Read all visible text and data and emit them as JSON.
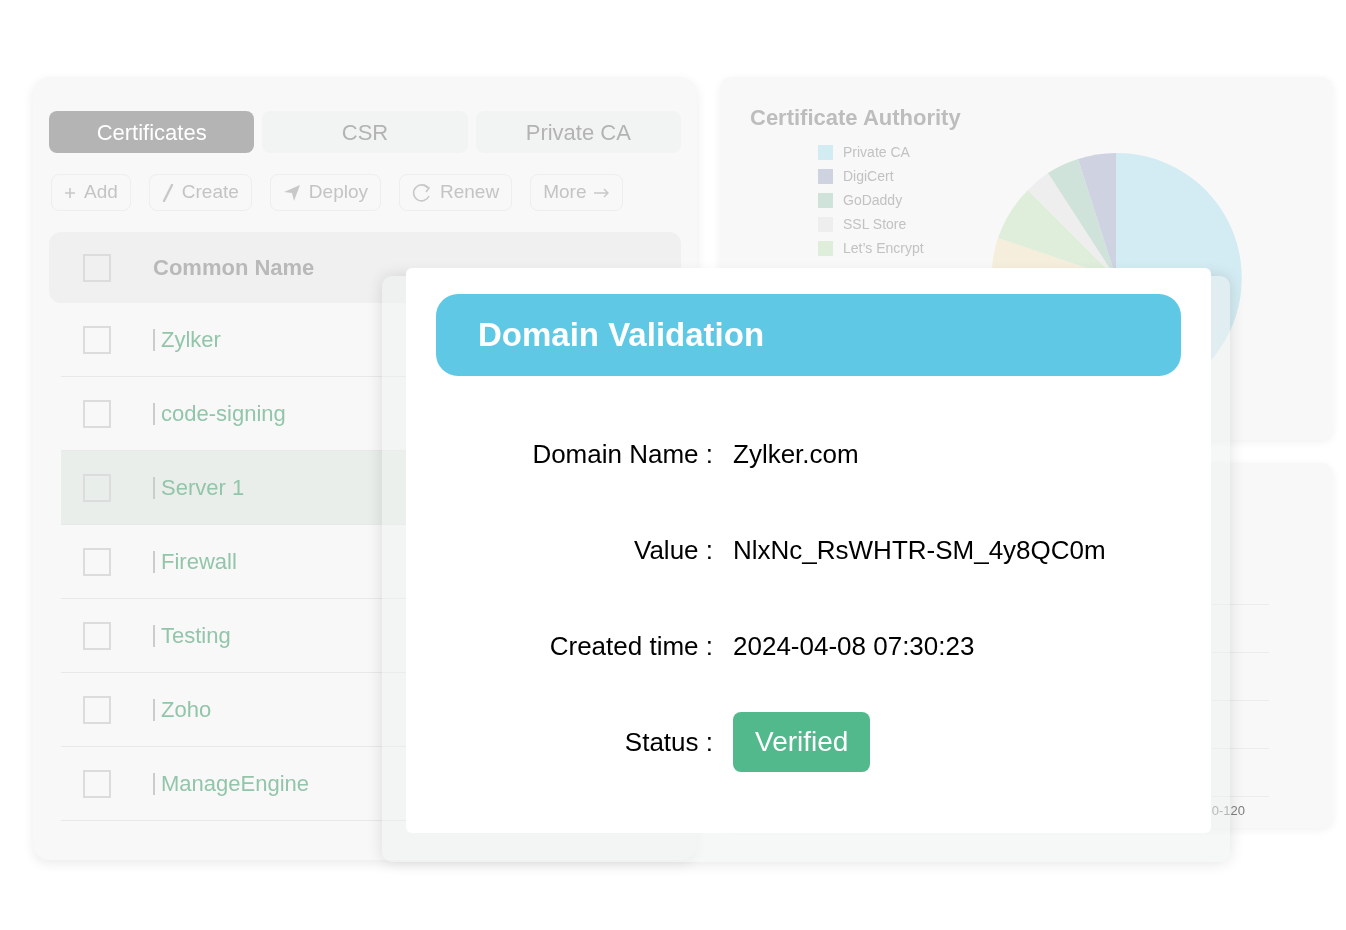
{
  "tabs": [
    {
      "label": "Certificates",
      "selected": true
    },
    {
      "label": "CSR",
      "selected": false
    },
    {
      "label": "Private CA",
      "selected": false
    }
  ],
  "toolbar": [
    {
      "label": "Add",
      "kind": "add"
    },
    {
      "label": "Create",
      "kind": "create"
    },
    {
      "label": "Deploy",
      "kind": "deploy"
    },
    {
      "label": "Renew",
      "kind": "renew"
    },
    {
      "label": "More",
      "kind": "more"
    }
  ],
  "table": {
    "columns": [
      "Common Name"
    ],
    "header_checked": false,
    "rows": [
      {
        "name": "Zylker",
        "checked": false,
        "selected": false
      },
      {
        "name": "code-signing",
        "checked": false,
        "selected": false
      },
      {
        "name": "Server 1",
        "checked": false,
        "selected": true
      },
      {
        "name": "Firewall",
        "checked": false,
        "selected": false
      },
      {
        "name": "Testing",
        "checked": false,
        "selected": false
      },
      {
        "name": "Zoho",
        "checked": false,
        "selected": false
      },
      {
        "name": "ManageEngine",
        "checked": false,
        "selected": false
      }
    ]
  },
  "ca_panel": {
    "title": "Certificate Authority",
    "legend": [
      {
        "label": "Private CA",
        "color": "#d3ebf2"
      },
      {
        "label": "DigiCert",
        "color": "#cfd3e1"
      },
      {
        "label": "GoDaddy",
        "color": "#cfe3da"
      },
      {
        "label": "SSL Store",
        "color": "#eeeeee"
      },
      {
        "label": "Let’s Encrypt",
        "color": "#dfeeda"
      }
    ]
  },
  "bar_panel": {
    "tick_label": "0-120"
  },
  "dialog": {
    "title": "Domain Validation",
    "fields": [
      {
        "label": "Domain Name :",
        "value": "Zylker.com",
        "kind": "text"
      },
      {
        "label": "Value :",
        "value": "NlxNc_RsWHTR-SM_4y8QC0m",
        "kind": "text"
      },
      {
        "label": "Created time :",
        "value": "2024-04-08 07:30:23",
        "kind": "text"
      },
      {
        "label": "Status :",
        "value": "Verified",
        "kind": "status"
      }
    ]
  }
}
